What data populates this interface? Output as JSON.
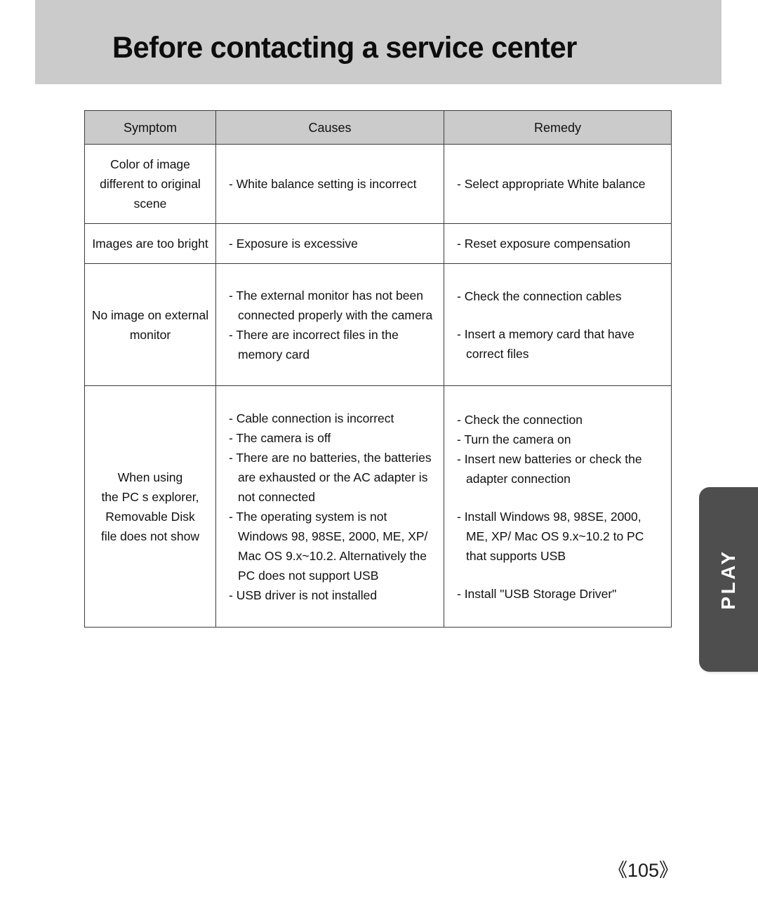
{
  "header": {
    "title": "Before contacting a service center"
  },
  "side_tab": {
    "label": "PLAY"
  },
  "footer": {
    "page_number": "《105》"
  },
  "table": {
    "columns": [
      "Symptom",
      "Causes",
      "Remedy"
    ],
    "rows": [
      {
        "symptom": "Color of image\ndifferent to original\nscene",
        "causes": [
          "- White balance setting is incorrect"
        ],
        "remedy": [
          "- Select appropriate White balance"
        ]
      },
      {
        "symptom": "Images are too bright",
        "causes": [
          "- Exposure is excessive"
        ],
        "remedy": [
          "- Reset exposure compensation"
        ]
      },
      {
        "symptom": "No image on external\nmonitor",
        "causes": [
          "- The external monitor has not been connected properly with the camera",
          "- There are incorrect files in the memory card"
        ],
        "remedy": [
          "- Check the connection cables",
          "- Insert a memory card that have correct files"
        ]
      },
      {
        "symptom": "When using\nthe PC s explorer,\nRemovable Disk\nfile does not show",
        "causes": [
          "- Cable connection is incorrect",
          "- The camera is off",
          "- There are no batteries, the batteries are exhausted or the AC adapter is not connected",
          "- The operating system is not Windows 98, 98SE, 2000, ME, XP/ Mac OS 9.x~10.2. Alternatively the PC does not support USB",
          "- USB driver is not installed"
        ],
        "remedy": [
          "- Check the connection",
          "- Turn the camera on",
          "- Insert new batteries or check the adapter connection",
          "- Install Windows 98, 98SE, 2000, ME, XP/ Mac OS 9.x~10.2 to PC that supports USB",
          "- Install \"USB Storage Driver\""
        ]
      }
    ]
  },
  "cells": {
    "r1_sym_l1": "Color of image",
    "r1_sym_l2": "different to original",
    "r1_sym_l3": "scene",
    "r1_cause_1": "- White balance setting is incorrect",
    "r1_remedy_1": "- Select appropriate White balance",
    "r2_sym": "Images are too bright",
    "r2_cause_1": "- Exposure is excessive",
    "r2_remedy_1": "- Reset exposure compensation",
    "r3_sym_l1": "No image on external",
    "r3_sym_l2": "monitor",
    "r3_cause_1": "- The external monitor has not been connected properly with the camera",
    "r3_cause_2": "- There are incorrect files in the memory card",
    "r3_remedy_1": "- Check the connection cables",
    "r3_remedy_2": "- Insert a memory card that have correct files",
    "r4_sym_l1": "When using",
    "r4_sym_l2": "the PC s explorer,",
    "r4_sym_l3": "Removable Disk",
    "r4_sym_l4": "file does not show",
    "r4_cause_1": "- Cable connection is incorrect",
    "r4_cause_2": "- The camera is off",
    "r4_cause_3": "- There are no batteries, the batteries are exhausted or the AC adapter is not connected",
    "r4_cause_4": "- The operating system is not Windows 98, 98SE, 2000, ME, XP/ Mac OS 9.x~10.2. Alternatively the PC does not support USB",
    "r4_cause_5": "- USB driver is not installed",
    "r4_remedy_1": "- Check the connection",
    "r4_remedy_2": "- Turn the camera on",
    "r4_remedy_3": "- Insert new batteries or check the adapter connection",
    "r4_remedy_4": "- Install Windows 98, 98SE, 2000, ME, XP/ Mac OS 9.x~10.2 to PC that supports USB",
    "r4_remedy_5": "- Install \"USB Storage Driver\""
  }
}
